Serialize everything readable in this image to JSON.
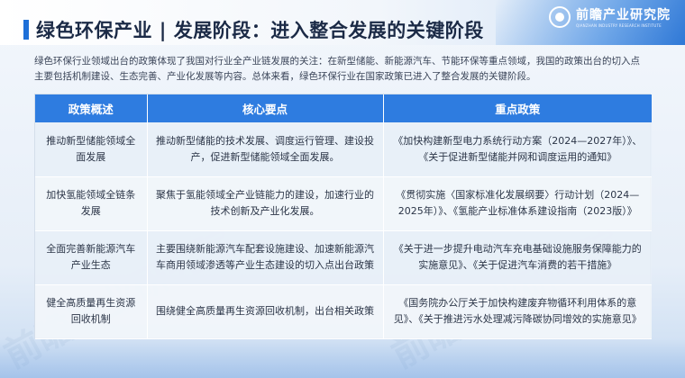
{
  "header": {
    "title": "绿色环保产业 | 发展阶段：进入整合发展的关键阶段",
    "logo_name": "前瞻产业研究院",
    "logo_sub": "QIANZHAN INDUSTRY RESEARCH INSTITUTE"
  },
  "intro": "绿色环保行业领域出台的政策体现了我国对行业全产业链发展的关注：在新型储能、新能源汽车、节能环保等重点领域，我国的政策出台的切入点主要包括机制建设、生态完善、产业化发展等内容。总体来看，绿色环保行业在国家政策已进入了整合发展的关键阶段。",
  "watermark": "前瞻产业研究院",
  "table": {
    "headers": [
      "政策概述",
      "核心要点",
      "重点政策"
    ],
    "rows": [
      {
        "summary": "推动新型储能领域全面发展",
        "points": "推动新型储能的技术发展、调度运行管理、建设投产，促进新型储能领域全面发展。",
        "policies": "《加快构建新型电力系统行动方案（2024—2027年）》、《关于促进新型储能并网和调度运用的通知》"
      },
      {
        "summary": "加快氢能领域全链条发展",
        "points": "聚焦于氢能领域全产业链能力的建设，加速行业的技术创新及产业化发展。",
        "policies": "《贯彻实施〈国家标准化发展纲要〉行动计划（2024—2025年）》、《氢能产业标准体系建设指南（2023版）》"
      },
      {
        "summary": "全面完善新能源汽车产业生态",
        "points": "主要围绕新能源汽车配套设施建设、加速新能源汽车商用领域渗透等产业生态建设的切入点出台政策",
        "policies": "《关于进一步提升电动汽车充电基础设施服务保障能力的实施意见》、《关于促进汽车消费的若干措施》"
      },
      {
        "summary": "健全高质量再生资源回收机制",
        "points": "围绕健全高质量再生资源回收机制，出台相关政策",
        "policies": "《国务院办公厅关于加快构建废弃物循环利用体系的意见》、《关于推进污水处理减污降碳协同增效的实施意见》"
      }
    ]
  }
}
